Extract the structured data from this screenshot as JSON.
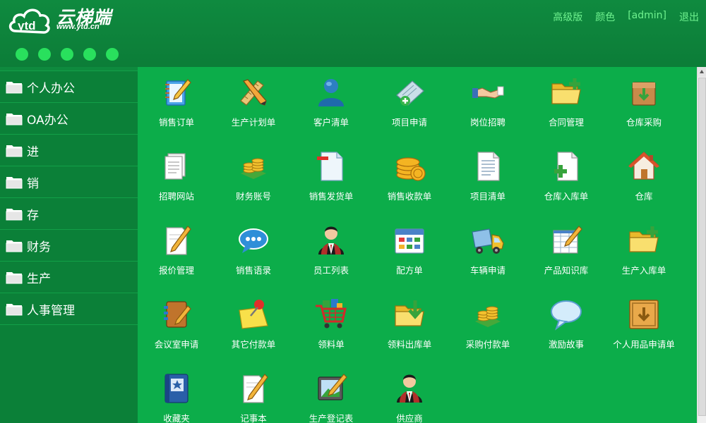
{
  "brand": {
    "name": "云梯端",
    "url": "www.ytd.cn"
  },
  "topnav": [
    "高级版",
    "颜色",
    "[admin]",
    "退出"
  ],
  "dots": 5,
  "sidebar": {
    "items": [
      {
        "label": "个人办公"
      },
      {
        "label": "OA办公"
      },
      {
        "label": "进"
      },
      {
        "label": "销"
      },
      {
        "label": "存"
      },
      {
        "label": "财务"
      },
      {
        "label": "生产"
      },
      {
        "label": "人事管理"
      }
    ]
  },
  "apps": [
    {
      "label": "销售订单",
      "icon": "notepad-pencil-icon"
    },
    {
      "label": "生产计划单",
      "icon": "ruler-pencil-icon"
    },
    {
      "label": "客户清单",
      "icon": "user-silhouette-icon"
    },
    {
      "label": "项目申请",
      "icon": "project-add-icon"
    },
    {
      "label": "岗位招聘",
      "icon": "handshake-icon"
    },
    {
      "label": "合同管理",
      "icon": "folder-add-icon"
    },
    {
      "label": "仓库采购",
      "icon": "box-download-icon"
    },
    {
      "label": "招聘网站",
      "icon": "documents-icon"
    },
    {
      "label": "财务账号",
      "icon": "coins-stack-icon"
    },
    {
      "label": "销售发货单",
      "icon": "document-remove-icon"
    },
    {
      "label": "销售收款单",
      "icon": "gold-coins-icon"
    },
    {
      "label": "项目清单",
      "icon": "document-lines-icon"
    },
    {
      "label": "仓库入库单",
      "icon": "document-add-icon"
    },
    {
      "label": "仓库",
      "icon": "house-icon"
    },
    {
      "label": "报价管理",
      "icon": "paper-pencil-icon"
    },
    {
      "label": "销售语录",
      "icon": "chat-bubble-icon"
    },
    {
      "label": "员工列表",
      "icon": "person-suit-icon"
    },
    {
      "label": "配方单",
      "icon": "calendar-grid-icon"
    },
    {
      "label": "车辆申请",
      "icon": "truck-icon"
    },
    {
      "label": "产品知识库",
      "icon": "spreadsheet-pencil-icon"
    },
    {
      "label": "生产入库单",
      "icon": "folder-add-icon"
    },
    {
      "label": "会议室申请",
      "icon": "address-book-icon"
    },
    {
      "label": "其它付款单",
      "icon": "note-pin-icon"
    },
    {
      "label": "领料单",
      "icon": "shopping-cart-icon"
    },
    {
      "label": "领料出库单",
      "icon": "folder-download-icon"
    },
    {
      "label": "采购付款单",
      "icon": "coins-stack-icon"
    },
    {
      "label": "激励故事",
      "icon": "speech-bubble-icon"
    },
    {
      "label": "个人用品申请单",
      "icon": "crate-download-icon"
    },
    {
      "label": "收藏夹",
      "icon": "book-star-icon"
    },
    {
      "label": "记事本",
      "icon": "paper-pencil-icon"
    },
    {
      "label": "生产登记表",
      "icon": "picture-pencil-icon"
    },
    {
      "label": "供应商",
      "icon": "person-suit-icon"
    }
  ]
}
